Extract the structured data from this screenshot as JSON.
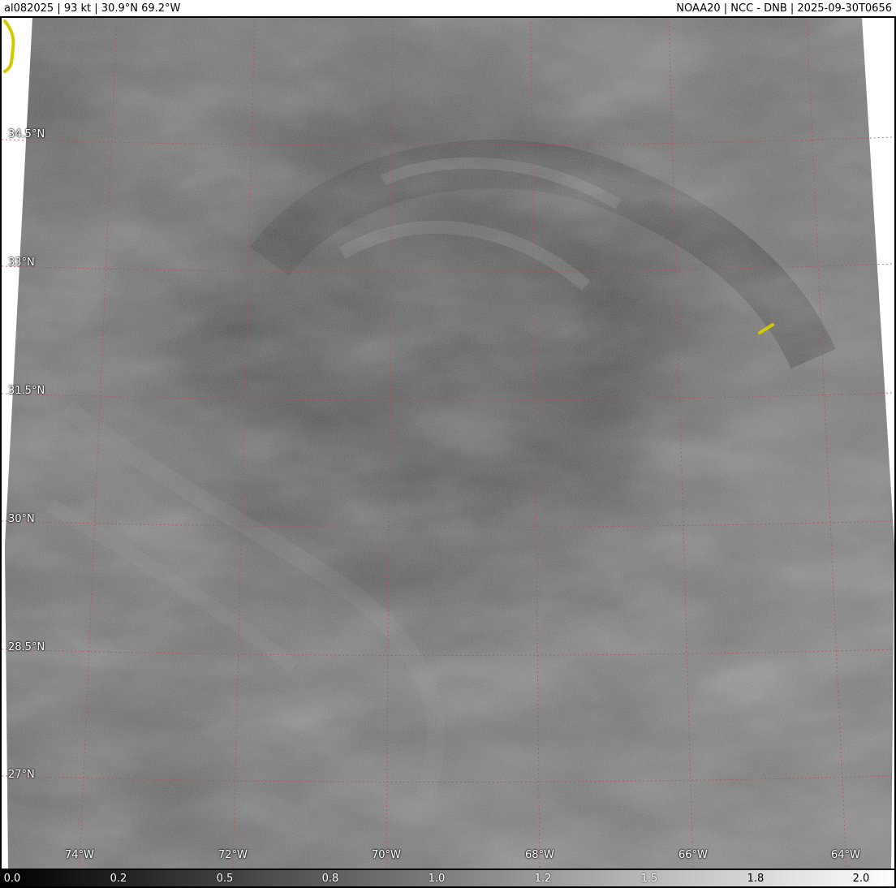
{
  "header": {
    "storm_info": "al082025     | 93 kt | 30.9°N 69.2°W",
    "product_info": "NOAA20 | NCC - DNB | 2025-09-30T0656"
  },
  "map": {
    "latitude_labels": [
      "34.5°N",
      "33°N",
      "31.5°N",
      "30°N",
      "28.5°N",
      "27°N"
    ],
    "longitude_labels": [
      "74°W",
      "72°W",
      "70°W",
      "68°W",
      "66°W",
      "64°W"
    ],
    "colors": {
      "gridline": "#c05050",
      "coastline": "#d4c800",
      "imagery_dark": "#3c3c3c",
      "imagery_light": "#8a8a8a"
    }
  },
  "colorbar": {
    "ticks": [
      "0.0",
      "0.2",
      "0.5",
      "0.8",
      "1.0",
      "1.2",
      "1.5",
      "1.8",
      "2.0"
    ],
    "range": [
      0.0,
      2.0
    ],
    "colormap": "grayscale"
  }
}
